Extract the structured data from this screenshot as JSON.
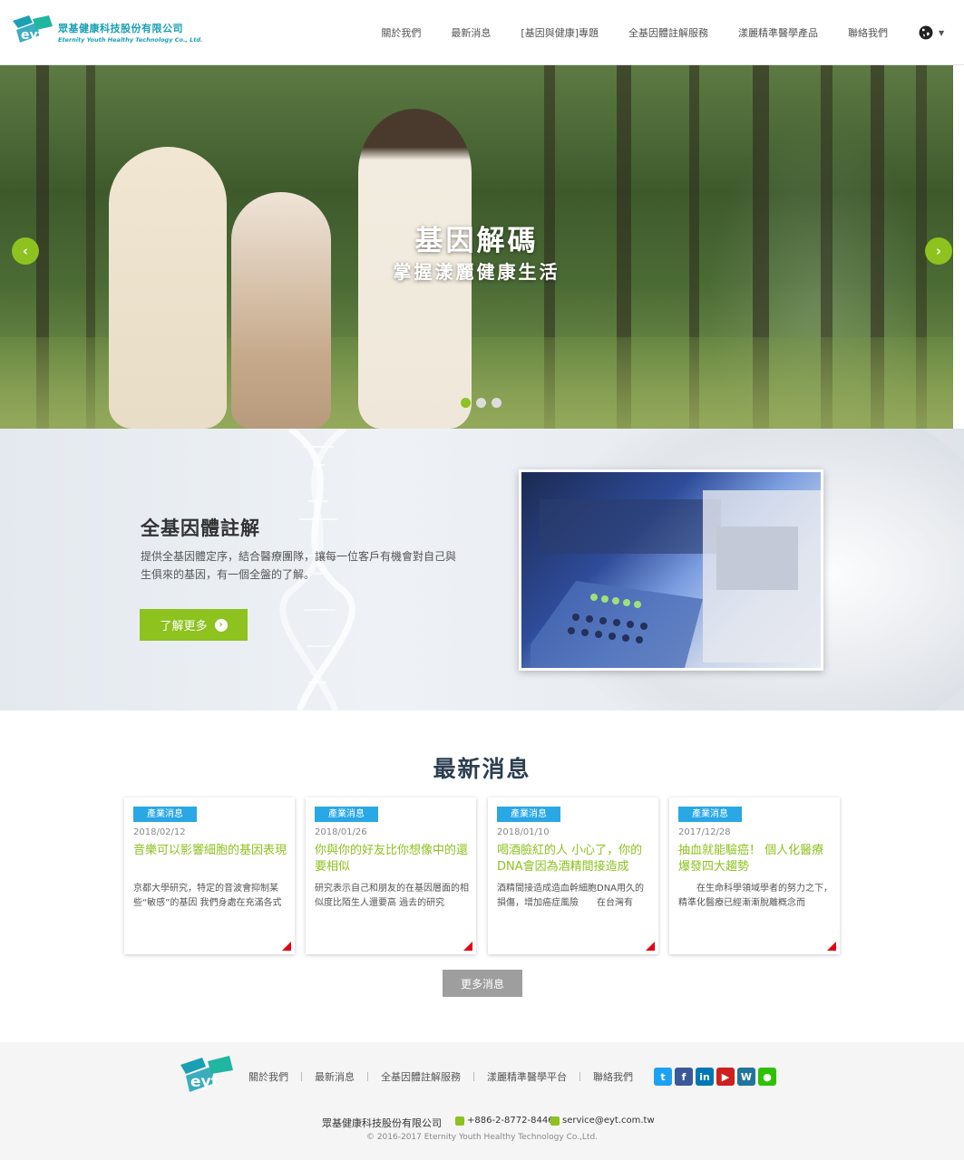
{
  "header": {
    "logo_cn": "眾基健康科技股份有限公司",
    "logo_en": "Eternity Youth Healthy Technology Co., Ltd.",
    "nav": [
      "關於我們",
      "最新消息",
      "[基因與健康]專題",
      "全基因體註解服務",
      "漾麗精準醫學產品",
      "聯絡我們"
    ],
    "language_icon": "globe-icon"
  },
  "hero": {
    "title": "基因解碼",
    "subtitle": "掌握漾麗健康生活",
    "prev_icon": "chevron-left-icon",
    "next_icon": "chevron-right-icon",
    "slide_count": 3,
    "active_slide": 1
  },
  "genome": {
    "title": "全基因體註解",
    "description": "提供全基因體定序，結合醫療團隊，讓每一位客戶有機會對自己與生俱來的基因，有一個全盤的了解。",
    "button": "了解更多"
  },
  "news": {
    "heading": "最新消息",
    "items": [
      {
        "tag": "產業消息",
        "date": "2018/02/12",
        "title": "音樂可以影響細胞的基因表現",
        "excerpt": "京都大學研究，特定的音波會抑制某些“敏感”的基因 我們身處在充滿各式"
      },
      {
        "tag": "產業消息",
        "date": "2018/01/26",
        "title": "你與你的好友比你想像中的還要相似",
        "excerpt": "研究表示自己和朋友的在基因層面的相似度比陌生人還要高 過去的研究"
      },
      {
        "tag": "產業消息",
        "date": "2018/01/10",
        "title": "喝酒臉紅的人 小心了，你的DNA會因為酒精間接造成",
        "excerpt": "酒精間接造成造血幹細胞DNA用久的損傷，增加癌症風險　　在台灣有"
      },
      {
        "tag": "產業消息",
        "date": "2017/12/28",
        "title": "抽血就能驗癌！ 個人化醫療爆發四大趨勢",
        "excerpt": "　　在生命科學領域學者的努力之下，精準化醫療已經漸漸脫離概念而"
      }
    ],
    "more_button": "更多消息"
  },
  "footer": {
    "nav": [
      "關於我們",
      "最新消息",
      "全基因體註解服務",
      "漾麗精準醫學平台",
      "聯絡我們"
    ],
    "social": [
      {
        "name": "twitter-icon",
        "glyph": "t",
        "color": "#1da1f2"
      },
      {
        "name": "facebook-icon",
        "glyph": "f",
        "color": "#3b5998"
      },
      {
        "name": "linkedin-icon",
        "glyph": "in",
        "color": "#0077b5"
      },
      {
        "name": "youtube-icon",
        "glyph": "▶",
        "color": "#cd201f"
      },
      {
        "name": "wordpress-icon",
        "glyph": "W",
        "color": "#21759b"
      },
      {
        "name": "wechat-icon",
        "glyph": "●",
        "color": "#2dc100"
      }
    ],
    "company": "眾基健康科技股份有限公司",
    "phone": "+886-2-8772-8446",
    "email": "service@eyt.com.tw",
    "copyright": "© 2016-2017 Eternity Youth Healthy Technology Co.,Ltd."
  }
}
